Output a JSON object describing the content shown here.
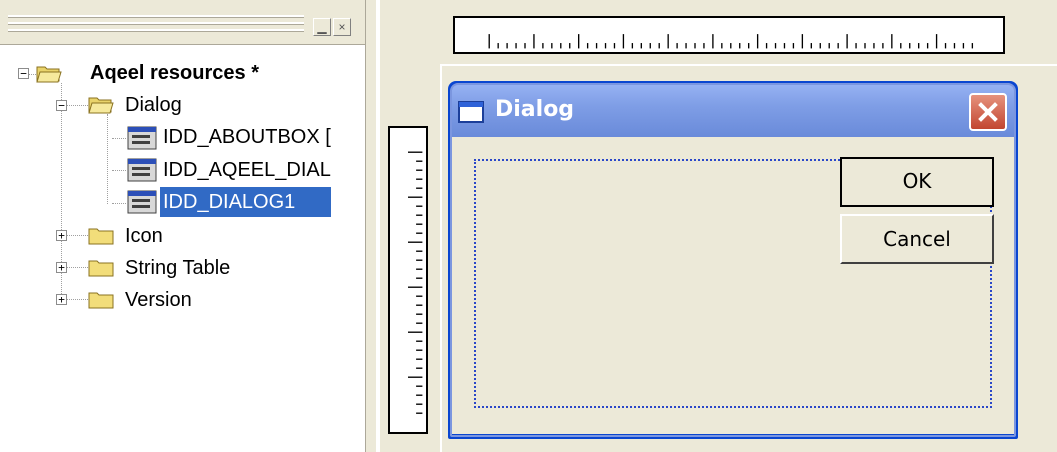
{
  "tree": {
    "root_label": "Aqeel resources *",
    "items": [
      {
        "label": "Dialog",
        "expander": "−"
      },
      {
        "label": "IDD_ABOUTBOX ["
      },
      {
        "label": "IDD_AQEEL_DIAL"
      },
      {
        "label": "IDD_DIALOG1",
        "selected": true
      },
      {
        "label": "Icon",
        "expander": "+"
      },
      {
        "label": "String Table",
        "expander": "+"
      },
      {
        "label": "Version",
        "expander": "+"
      }
    ],
    "root_expander": "−",
    "header_buttons": [
      "▁",
      "×"
    ]
  },
  "dialog": {
    "title": "Dialog",
    "ok_label": "OK",
    "cancel_label": "Cancel"
  },
  "colors": {
    "selection": "#316ac5",
    "title_bar": "#7f9ee6",
    "close_button": "#c24631",
    "face": "#ece9d8"
  }
}
